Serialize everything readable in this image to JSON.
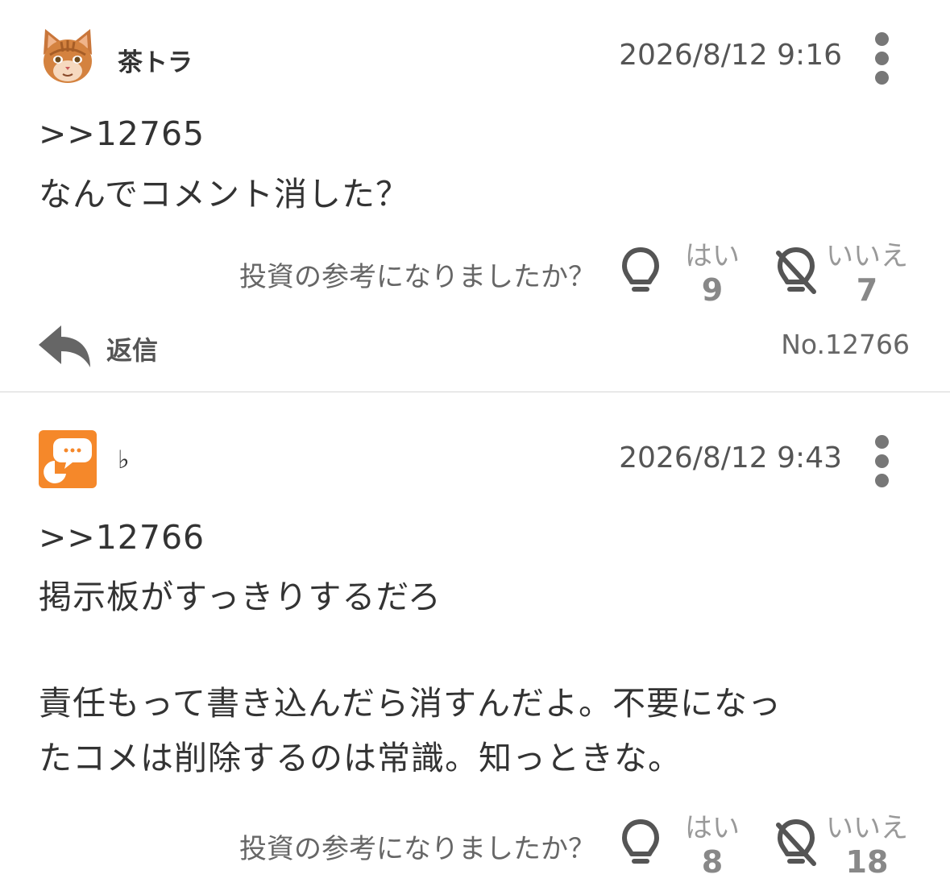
{
  "posts": [
    {
      "username": "茶トラ",
      "avatar": "cat-avatar",
      "timestamp": "2026/8/12 9:16",
      "body": [
        ">>12765",
        "なんでコメント消した？"
      ],
      "vote_question": "投資の参考になりましたか？",
      "yes_label": "はい",
      "yes_count": "9",
      "no_label": "いいえ",
      "no_count": "7",
      "reply_label": "返信",
      "post_number": "No.12766"
    },
    {
      "username": "♭",
      "avatar": "speech-bubble-avatar",
      "avatar_color": "#f5882a",
      "timestamp": "2026/8/12 9:43",
      "body": [
        ">>12766",
        "掲示板がすっきりするだろ",
        "",
        "責任もって書き込んだら消すんだよ。不要になっ",
        "たコメは削除するのは常識。知っときな。"
      ],
      "vote_question": "投資の参考になりましたか？",
      "yes_label": "はい",
      "yes_count": "8",
      "no_label": "いいえ",
      "no_count": "18"
    }
  ]
}
